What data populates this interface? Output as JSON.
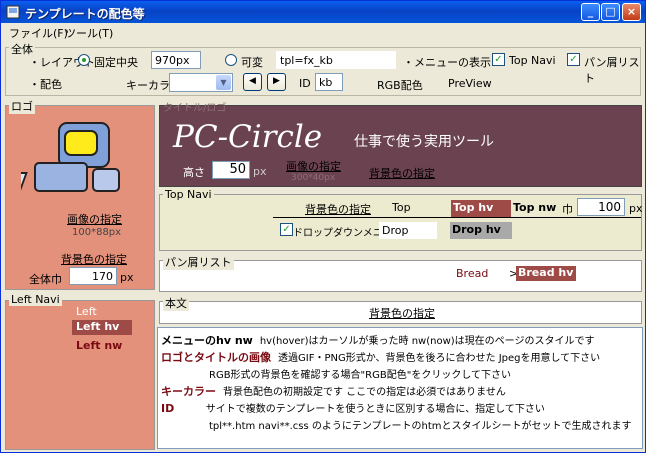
{
  "window": {
    "title": "テンプレートの配色等"
  },
  "menu": {
    "file": "ファイル(F)",
    "tool": "ツール(T)"
  },
  "zentai": {
    "legend": "全体",
    "layout_label": "・レイアウト",
    "fixed_label": "固定中央",
    "width_value": "970px",
    "variable_label": "可変",
    "template_name": "tpl=fx_kb",
    "menu_display_label": "・メニューの表示",
    "topnavi_label": "Top Navi",
    "breadcrumb_label": "パン屑リスト",
    "color_label": "・配色",
    "keycolor_label": "キーカラー",
    "id_label": "ID",
    "id_value": "kb",
    "rgb_label": "RGB配色",
    "preview_label": "PreView"
  },
  "logo": {
    "legend": "ロゴ",
    "image_link": "画像の指定",
    "image_size": "100*88px",
    "bg_link": "背景色の指定",
    "width_label": "全体巾",
    "width_value": "170",
    "width_unit": "px"
  },
  "header": {
    "legend": "タイトル/ロゴ",
    "site_title": "PC-Circle",
    "subtitle": "仕事で使う実用ツール",
    "height_label": "高さ",
    "height_value": "50",
    "height_unit": "px",
    "image_link": "画像の指定",
    "image_size": "300*40px",
    "bg_link": "背景色の指定"
  },
  "topnavi": {
    "legend": "Top Navi",
    "bg_link": "背景色の指定",
    "top_label": "Top",
    "top_hv": "Top hv",
    "top_nw": "Top nw",
    "width_label": "巾",
    "width_value": "100",
    "width_unit": "px",
    "dropdown_label": "ドロップダウンメニュー",
    "drop_value": "Drop",
    "drop_hv": "Drop hv"
  },
  "breadcrumb": {
    "legend": "パン屑リスト",
    "bread": "Bread",
    "bread_hv": "Bread hv",
    "separator": ">"
  },
  "leftnavi": {
    "legend": "Left Navi",
    "left": "Left",
    "left_hv": "Left hv",
    "left_nw": "Left nw"
  },
  "body": {
    "legend": "本文",
    "bg_link": "背景色の指定"
  },
  "help": [
    {
      "term": "メニューのhv nw",
      "text": "hv(hover)はカーソルが乗った時  nw(now)は現在のページのスタイルです"
    },
    {
      "term": "ロゴとタイトルの画像",
      "text": "透過GIF・PNG形式か、背景色を後ろに合わせた Jpegを用意して下さい"
    },
    {
      "term": "",
      "text": "RGB形式の背景色を確認する場合\"RGB配色\"をクリックして下さい"
    },
    {
      "term": "キーカラー",
      "text": "背景色配色の初期設定です  ここでの指定は必須ではありません"
    },
    {
      "term": "ID",
      "text": "サイトで複数のテンプレートを使うときに区別する場合に、指定して下さい"
    },
    {
      "term": "",
      "text": "tpl**.htm navi**.css のようにテンプレートのhtmとスタイルシートがセットで生成されます"
    }
  ],
  "colors": {
    "title_bar": "#0a5fef",
    "salmon": "#e4917c",
    "header_bg": "#6b4350",
    "topnavi_bg": "#ecebd0",
    "hv_bg": "#9e4a47",
    "nw_text": "#7a0a12",
    "drop_hv_bg": "#a9a9a9"
  }
}
